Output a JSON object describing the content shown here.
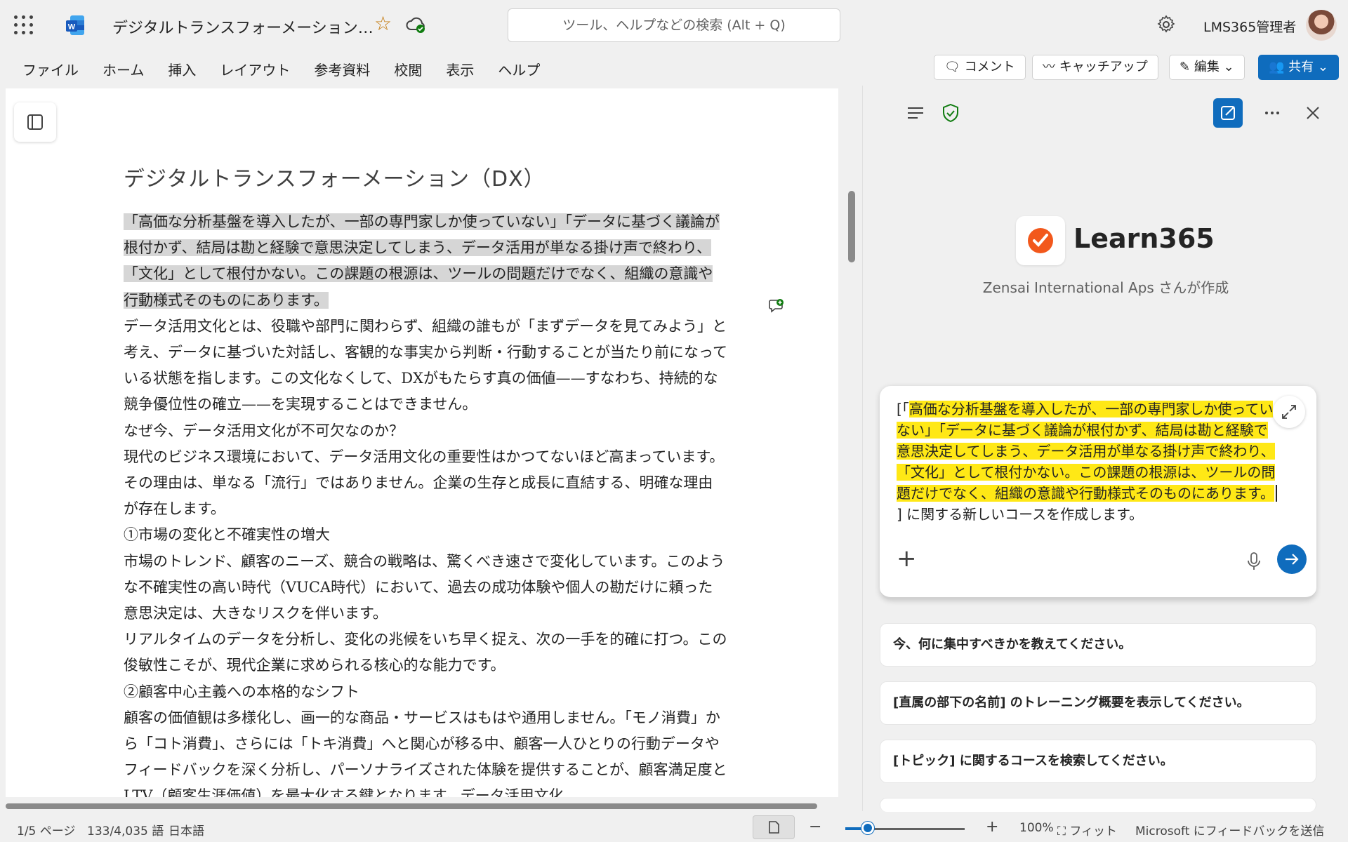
{
  "titlebar": {
    "doc_title": "デジタルトランスフォーメーション…",
    "search_placeholder": "ツール、ヘルプなどの検索 (Alt + Q)",
    "user_name": "LMS365管理者"
  },
  "ribbon": {
    "menu": [
      "ファイル",
      "ホーム",
      "挿入",
      "レイアウト",
      "参考資料",
      "校閲",
      "表示",
      "ヘルプ"
    ],
    "comment_label": "コメント",
    "catchup_label": "キャッチアップ",
    "edit_label": "編集",
    "share_label": "共有"
  },
  "document": {
    "heading": "デジタルトランスフォーメーション（DX）",
    "highlight_para": "「高価な分析基盤を導入したが、一部の専門家しか使っていない」「データに基づく議論が根付かず、結局は勘と経験で意思決定してしまう、データ活用が単なる掛け声で終わり、「文化」として根付かない。この課題の根源は、ツールの問題だけでなく、組織の意識や行動様式そのものにあります。",
    "paragraphs": [
      "データ活用文化とは、役職や部門に関わらず、組織の誰もが「まずデータを見てみよう」と考え、データに基づいた対話し、客観的な事実から判断・行動することが当たり前になっている状態を指します。この文化なくして、DXがもたらす真の価値——すなわち、持続的な競争優位性の確立——を実現することはできません。",
      "なぜ今、データ活用文化が不可欠なのか？",
      "現代のビジネス環境において、データ活用文化の重要性はかつてないほど高まっています。その理由は、単なる「流行」ではありません。企業の生存と成長に直結する、明確な理由が存在します。",
      "①市場の変化と不確実性の増大",
      "市場のトレンド、顧客のニーズ、競合の戦略は、驚くべき速さで変化しています。このような不確実性の高い時代（VUCA時代）において、過去の成功体験や個人の勘だけに頼った意思決定は、大きなリスクを伴います。",
      "リアルタイムのデータを分析し、変化の兆候をいち早く捉え、次の一手を的確に打つ。この俊敏性こそが、現代企業に求められる核心的な能力です。",
      "②顧客中心主義への本格的なシフト",
      "顧客の価値観は多様化し、画一的な商品・サービスはもはや通用しません。「モノ消費」から「コト消費」、さらには「トキ消費」へと関心が移る中、顧客一人ひとりの行動データやフィードバックを深く分析し、パーソナライズされた体験を提供することが、顧客満足度とLTV（顧客生涯価値）を最大化する鍵となります。データ活用文化"
    ]
  },
  "pane": {
    "brand_name": "Learn365",
    "brand_sub": "Zensai International Aps さんが作成",
    "prompt_open": "[「",
    "prompt_highlight": "高価な分析基盤を導入したが、一部の専門家しか使っていない」「データに基づく議論が根付かず、結局は勘と経験で意思決定してしまう、データ活用が単なる掛け声で終わり、「文化」として根付かない。この課題の根源は、ツールの問題だけでなく、組織の意識や行動様式そのものにあります。",
    "prompt_tail": "] に関する新しいコースを作成します。",
    "suggestions": [
      "今、何に集中すべきかを教えてください。",
      "[直属の部下の名前] のトレーニング概要を表示してください。",
      "[トピック] に関するコースを検索してください。"
    ]
  },
  "statusbar": {
    "page": "1/5 ページ",
    "words": "133/4,035 語",
    "language": "日本語",
    "zoom": "100%",
    "fit": "フィット",
    "feedback": "Microsoft にフィードバックを送信",
    "zoom_level": 0.19
  },
  "colors": {
    "accent": "#0f6cbd",
    "highlight_yellow": "#ffe816",
    "selection_gray": "#d6d6d6"
  }
}
